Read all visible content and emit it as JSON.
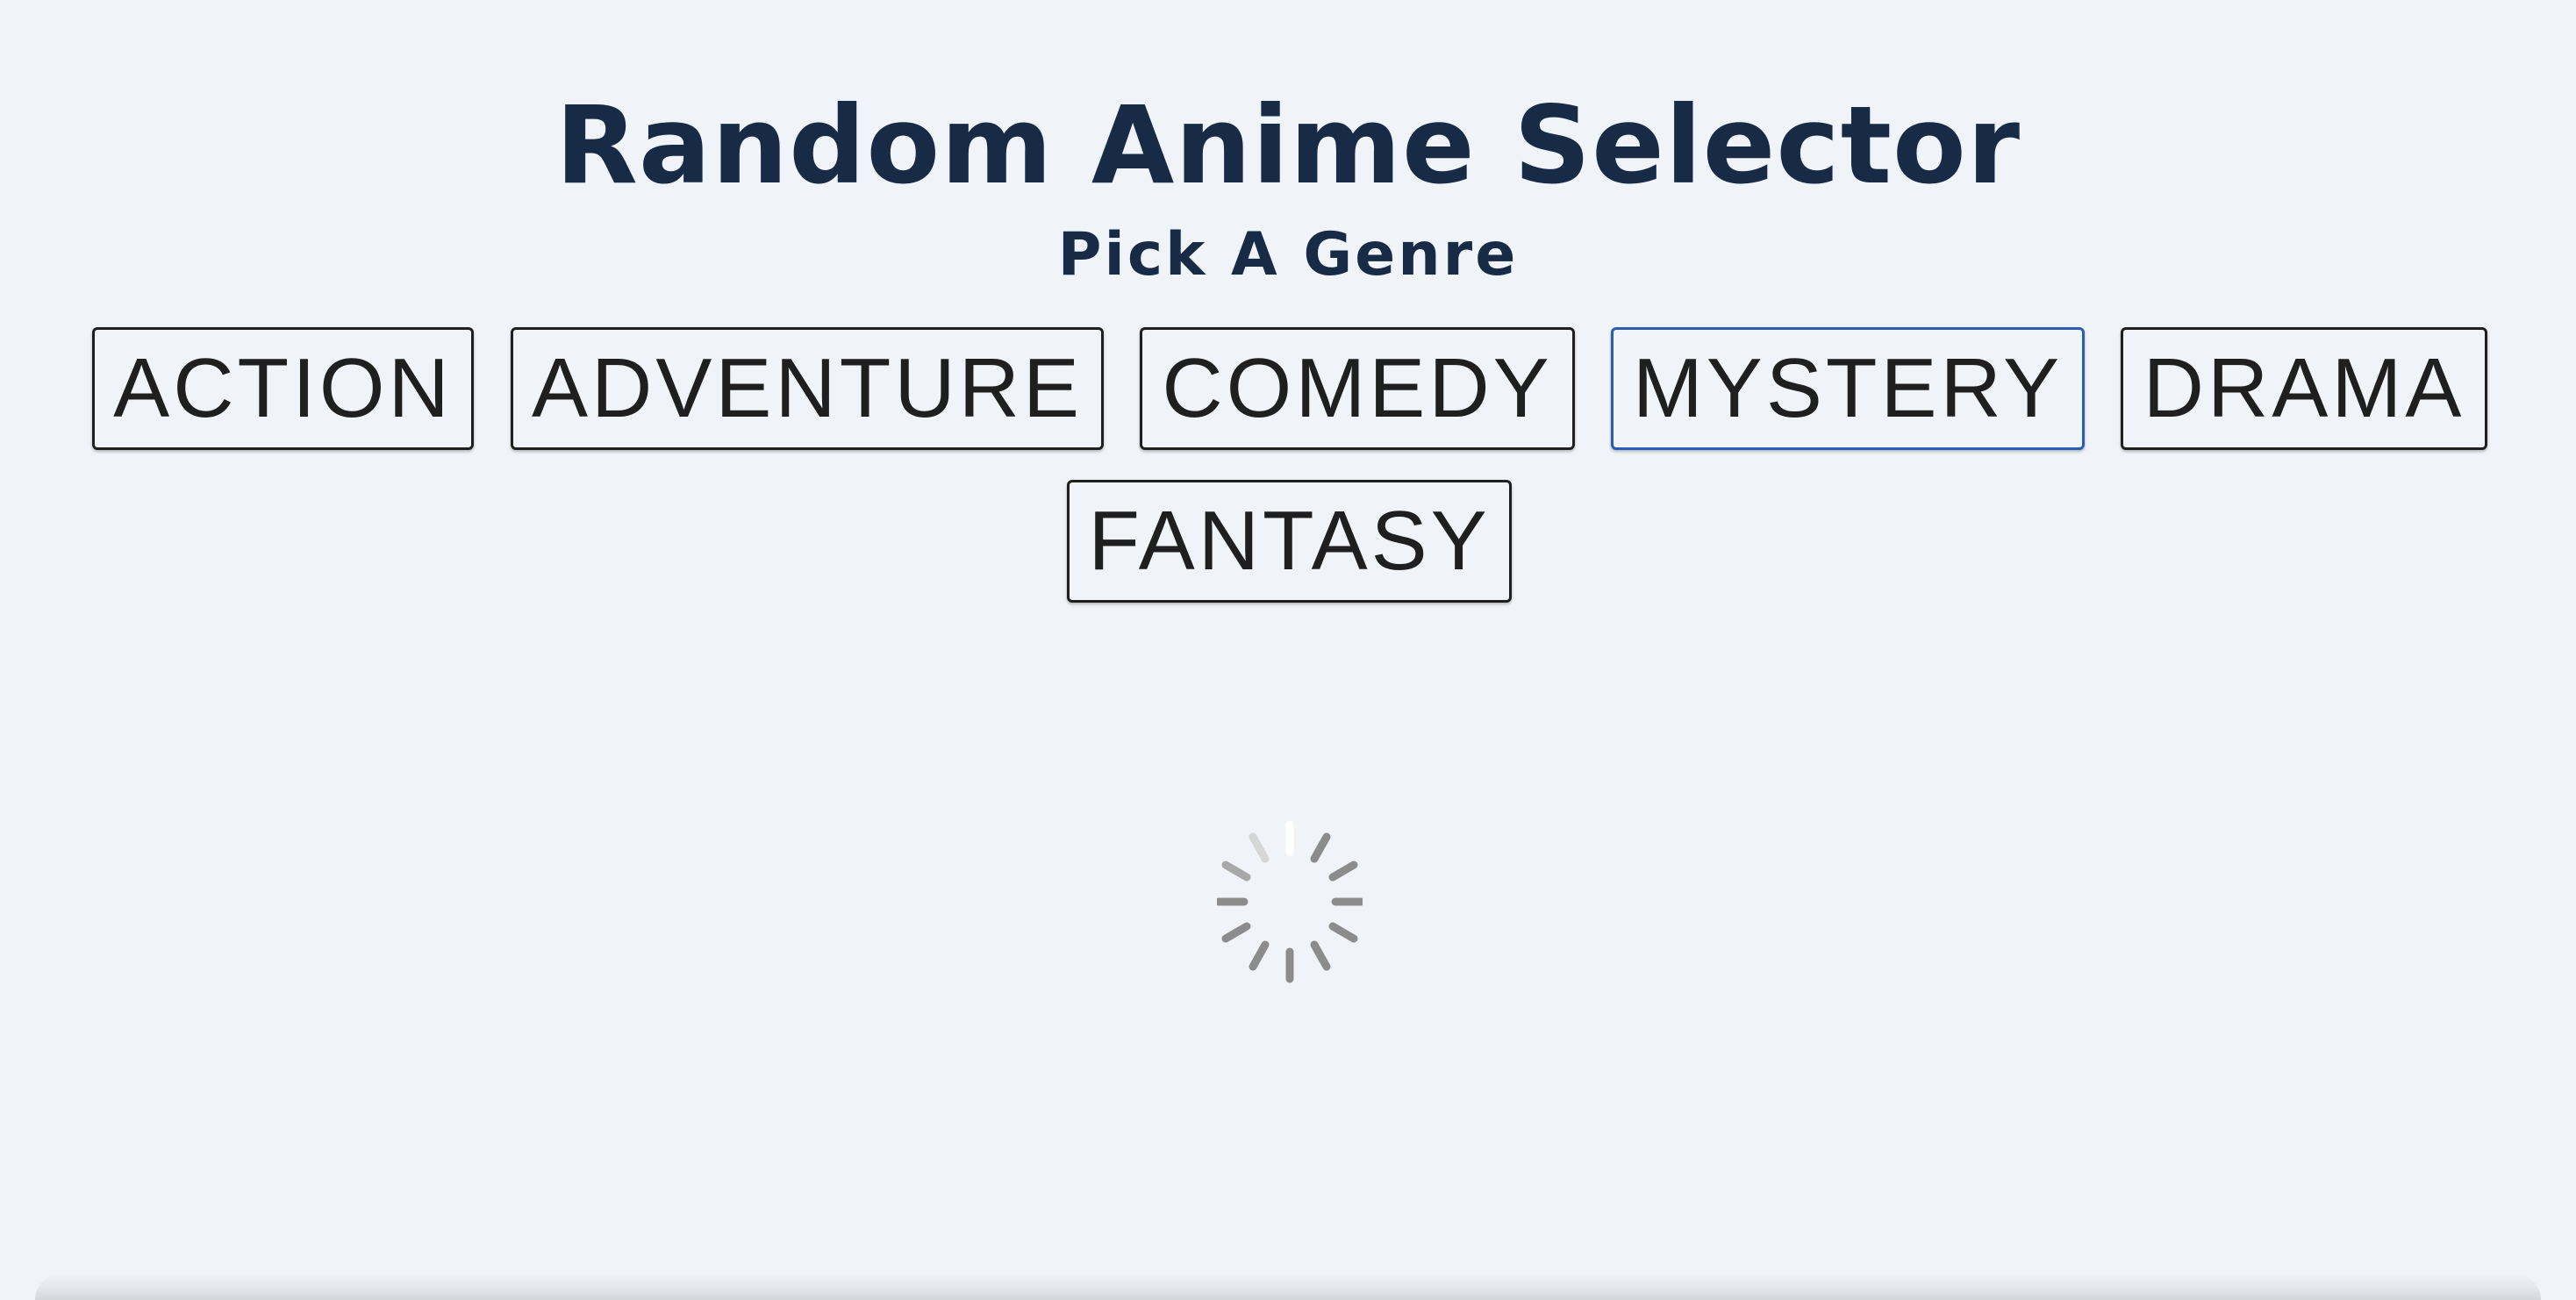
{
  "app": {
    "title": "Random Anime Selector",
    "subtitle": "Pick A Genre"
  },
  "genres": [
    {
      "label": "ACTION"
    },
    {
      "label": "ADVENTURE"
    },
    {
      "label": "COMEDY"
    },
    {
      "label": "MYSTERY",
      "focused": true
    },
    {
      "label": "DRAMA"
    },
    {
      "label": "FANTASY"
    }
  ],
  "loading": {
    "icon": "loading-spinner-icon"
  },
  "colors": {
    "background": "#f0f4f8",
    "heading": "#172a46",
    "button_border": "#1f1f1f",
    "focus_border": "#2a5db0",
    "spinner": "#888888"
  }
}
